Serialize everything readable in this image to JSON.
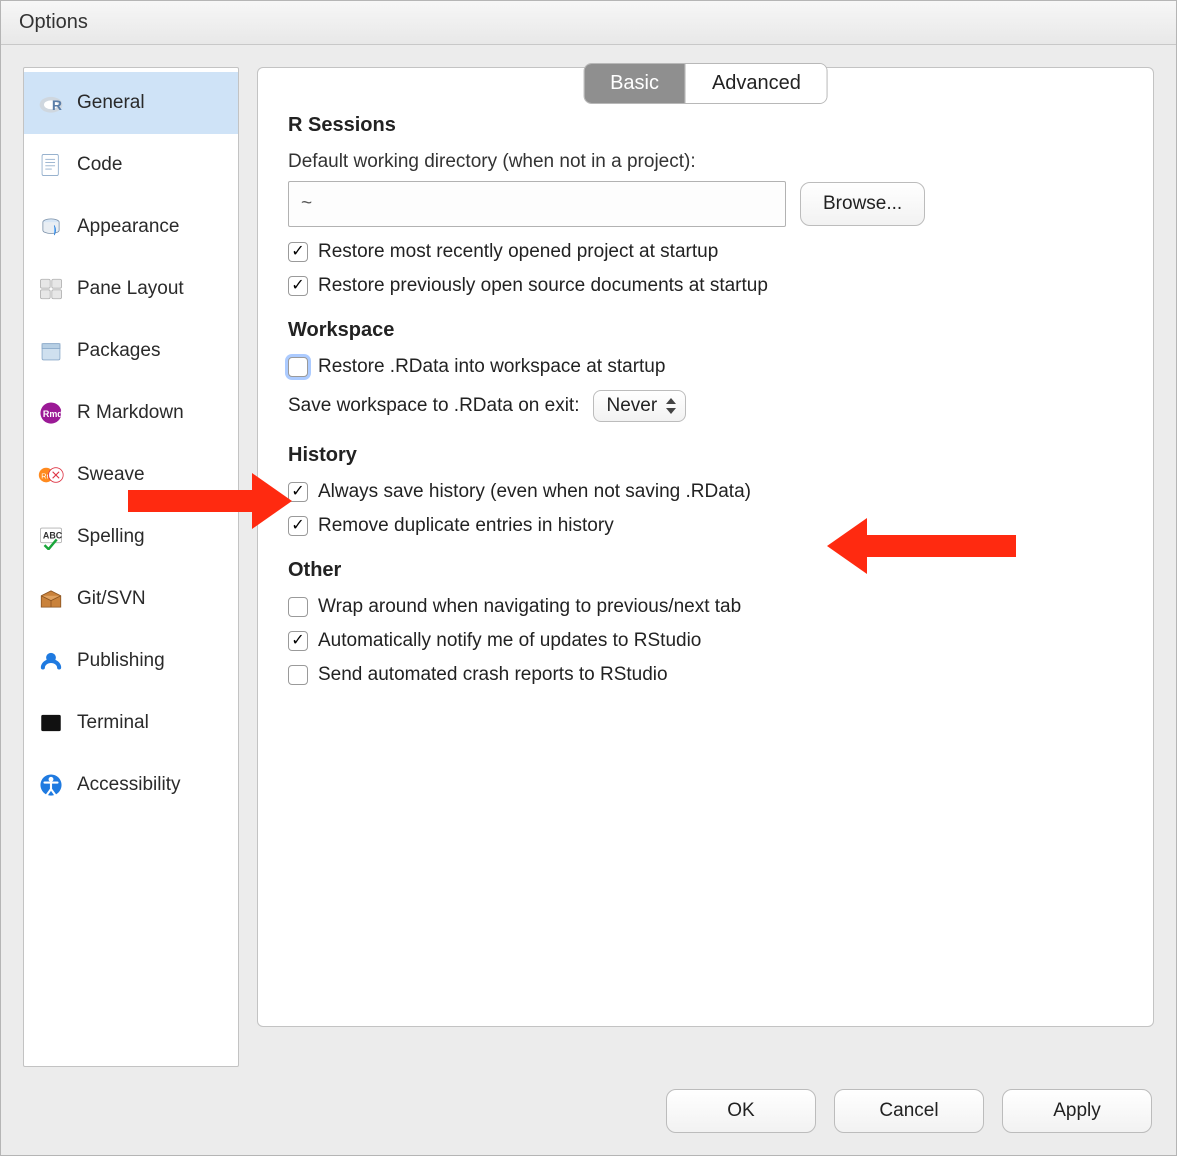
{
  "title": "Options",
  "sidebar": {
    "items": [
      {
        "label": "General"
      },
      {
        "label": "Code"
      },
      {
        "label": "Appearance"
      },
      {
        "label": "Pane Layout"
      },
      {
        "label": "Packages"
      },
      {
        "label": "R Markdown"
      },
      {
        "label": "Sweave"
      },
      {
        "label": "Spelling"
      },
      {
        "label": "Git/SVN"
      },
      {
        "label": "Publishing"
      },
      {
        "label": "Terminal"
      },
      {
        "label": "Accessibility"
      }
    ],
    "selected_index": 0
  },
  "tabs": {
    "items": [
      "Basic",
      "Advanced"
    ],
    "active_index": 0
  },
  "sections": {
    "rsessions": {
      "heading": "R Sessions",
      "workdir_label": "Default working directory (when not in a project):",
      "workdir_value": "~",
      "browse_label": "Browse...",
      "restore_project": {
        "label": "Restore most recently opened project at startup",
        "checked": true
      },
      "restore_docs": {
        "label": "Restore previously open source documents at startup",
        "checked": true
      }
    },
    "workspace": {
      "heading": "Workspace",
      "restore_rdata": {
        "label": "Restore .RData into workspace at startup",
        "checked": false
      },
      "save_label": "Save workspace to .RData on exit:",
      "save_value": "Never"
    },
    "history": {
      "heading": "History",
      "always_save": {
        "label": "Always save history (even when not saving .RData)",
        "checked": true
      },
      "remove_dup": {
        "label": "Remove duplicate entries in history",
        "checked": true
      }
    },
    "other": {
      "heading": "Other",
      "wrap_tabs": {
        "label": "Wrap around when navigating to previous/next tab",
        "checked": false
      },
      "notify_updates": {
        "label": "Automatically notify me of updates to RStudio",
        "checked": true
      },
      "crash_reports": {
        "label": "Send automated crash reports to RStudio",
        "checked": false
      }
    }
  },
  "footer": {
    "ok": "OK",
    "cancel": "Cancel",
    "apply": "Apply"
  }
}
